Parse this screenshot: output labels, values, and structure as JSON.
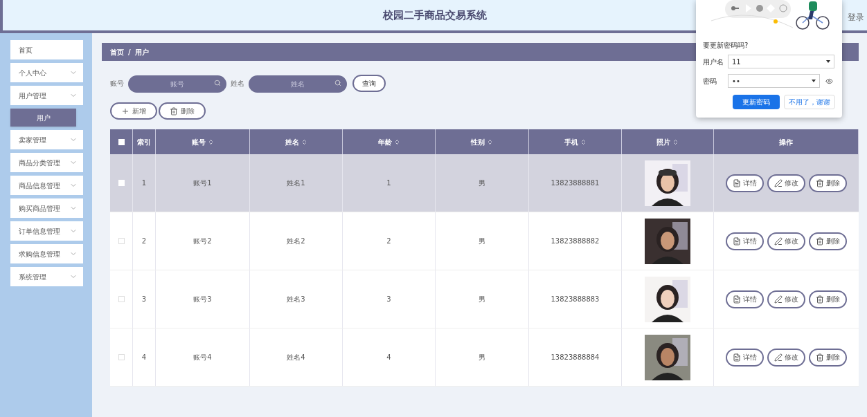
{
  "header": {
    "title": "校园二手商品交易系统",
    "login": "登录"
  },
  "sidebar": {
    "items": [
      {
        "label": "首页",
        "expandable": false
      },
      {
        "label": "个人中心",
        "expandable": true
      },
      {
        "label": "用户管理",
        "expandable": true,
        "children": [
          {
            "label": "用户",
            "selected": true
          }
        ]
      },
      {
        "label": "卖家管理",
        "expandable": true
      },
      {
        "label": "商品分类管理",
        "expandable": true
      },
      {
        "label": "商品信息管理",
        "expandable": true
      },
      {
        "label": "购买商品管理",
        "expandable": true
      },
      {
        "label": "订单信息管理",
        "expandable": true
      },
      {
        "label": "求购信息管理",
        "expandable": true
      },
      {
        "label": "系统管理",
        "expandable": true
      }
    ]
  },
  "breadcrumb": {
    "items": [
      "首页",
      "用户"
    ],
    "separator": "/"
  },
  "search": {
    "fields": [
      {
        "label": "账号",
        "placeholder": "账号"
      },
      {
        "label": "姓名",
        "placeholder": "姓名"
      }
    ],
    "button": "查询"
  },
  "actions": [
    {
      "kind": "add",
      "label": "新增"
    },
    {
      "kind": "delete",
      "label": "删除"
    }
  ],
  "table": {
    "header_checked": false,
    "columns": [
      {
        "label": "索引",
        "sortable": false
      },
      {
        "label": "账号",
        "sortable": true
      },
      {
        "label": "姓名",
        "sortable": true
      },
      {
        "label": "年龄",
        "sortable": true
      },
      {
        "label": "性别",
        "sortable": true
      },
      {
        "label": "手机",
        "sortable": true
      },
      {
        "label": "照片",
        "sortable": true
      },
      {
        "label": "操作",
        "sortable": false
      }
    ],
    "rows": [
      {
        "selected": true,
        "checked": false,
        "cells": [
          "1",
          "账号1",
          "姓名1",
          "1",
          "男",
          "13823888881"
        ],
        "photo": {
          "kind": "picture"
        },
        "actions": [
          {
            "kind": "detail",
            "label": "详情"
          },
          {
            "kind": "edit",
            "label": "修改"
          },
          {
            "kind": "delete",
            "label": "删除"
          }
        ]
      },
      {
        "selected": false,
        "checked": false,
        "cells": [
          "2",
          "账号2",
          "姓名2",
          "2",
          "男",
          "13823888882"
        ],
        "photo": {
          "kind": "picture"
        },
        "actions": [
          {
            "kind": "detail",
            "label": "详情"
          },
          {
            "kind": "edit",
            "label": "修改"
          },
          {
            "kind": "delete",
            "label": "删除"
          }
        ]
      },
      {
        "selected": false,
        "checked": false,
        "cells": [
          "3",
          "账号3",
          "姓名3",
          "3",
          "男",
          "13823888883"
        ],
        "photo": {
          "kind": "picture"
        },
        "actions": [
          {
            "kind": "detail",
            "label": "详情"
          },
          {
            "kind": "edit",
            "label": "修改"
          },
          {
            "kind": "delete",
            "label": "删除"
          }
        ]
      },
      {
        "selected": false,
        "checked": false,
        "cells": [
          "4",
          "账号4",
          "姓名4",
          "4",
          "男",
          "13823888884"
        ],
        "photo": {
          "kind": "picture"
        },
        "actions": [
          {
            "kind": "detail",
            "label": "详情"
          },
          {
            "kind": "edit",
            "label": "修改"
          },
          {
            "kind": "delete",
            "label": "删除"
          }
        ]
      }
    ]
  },
  "password_popup": {
    "question": "要更新密码吗?",
    "username_label": "用户名",
    "username": "11",
    "password_label": "密码",
    "password": "••",
    "primary_button": "更新密码",
    "secondary_button": "不用了，谢谢"
  }
}
